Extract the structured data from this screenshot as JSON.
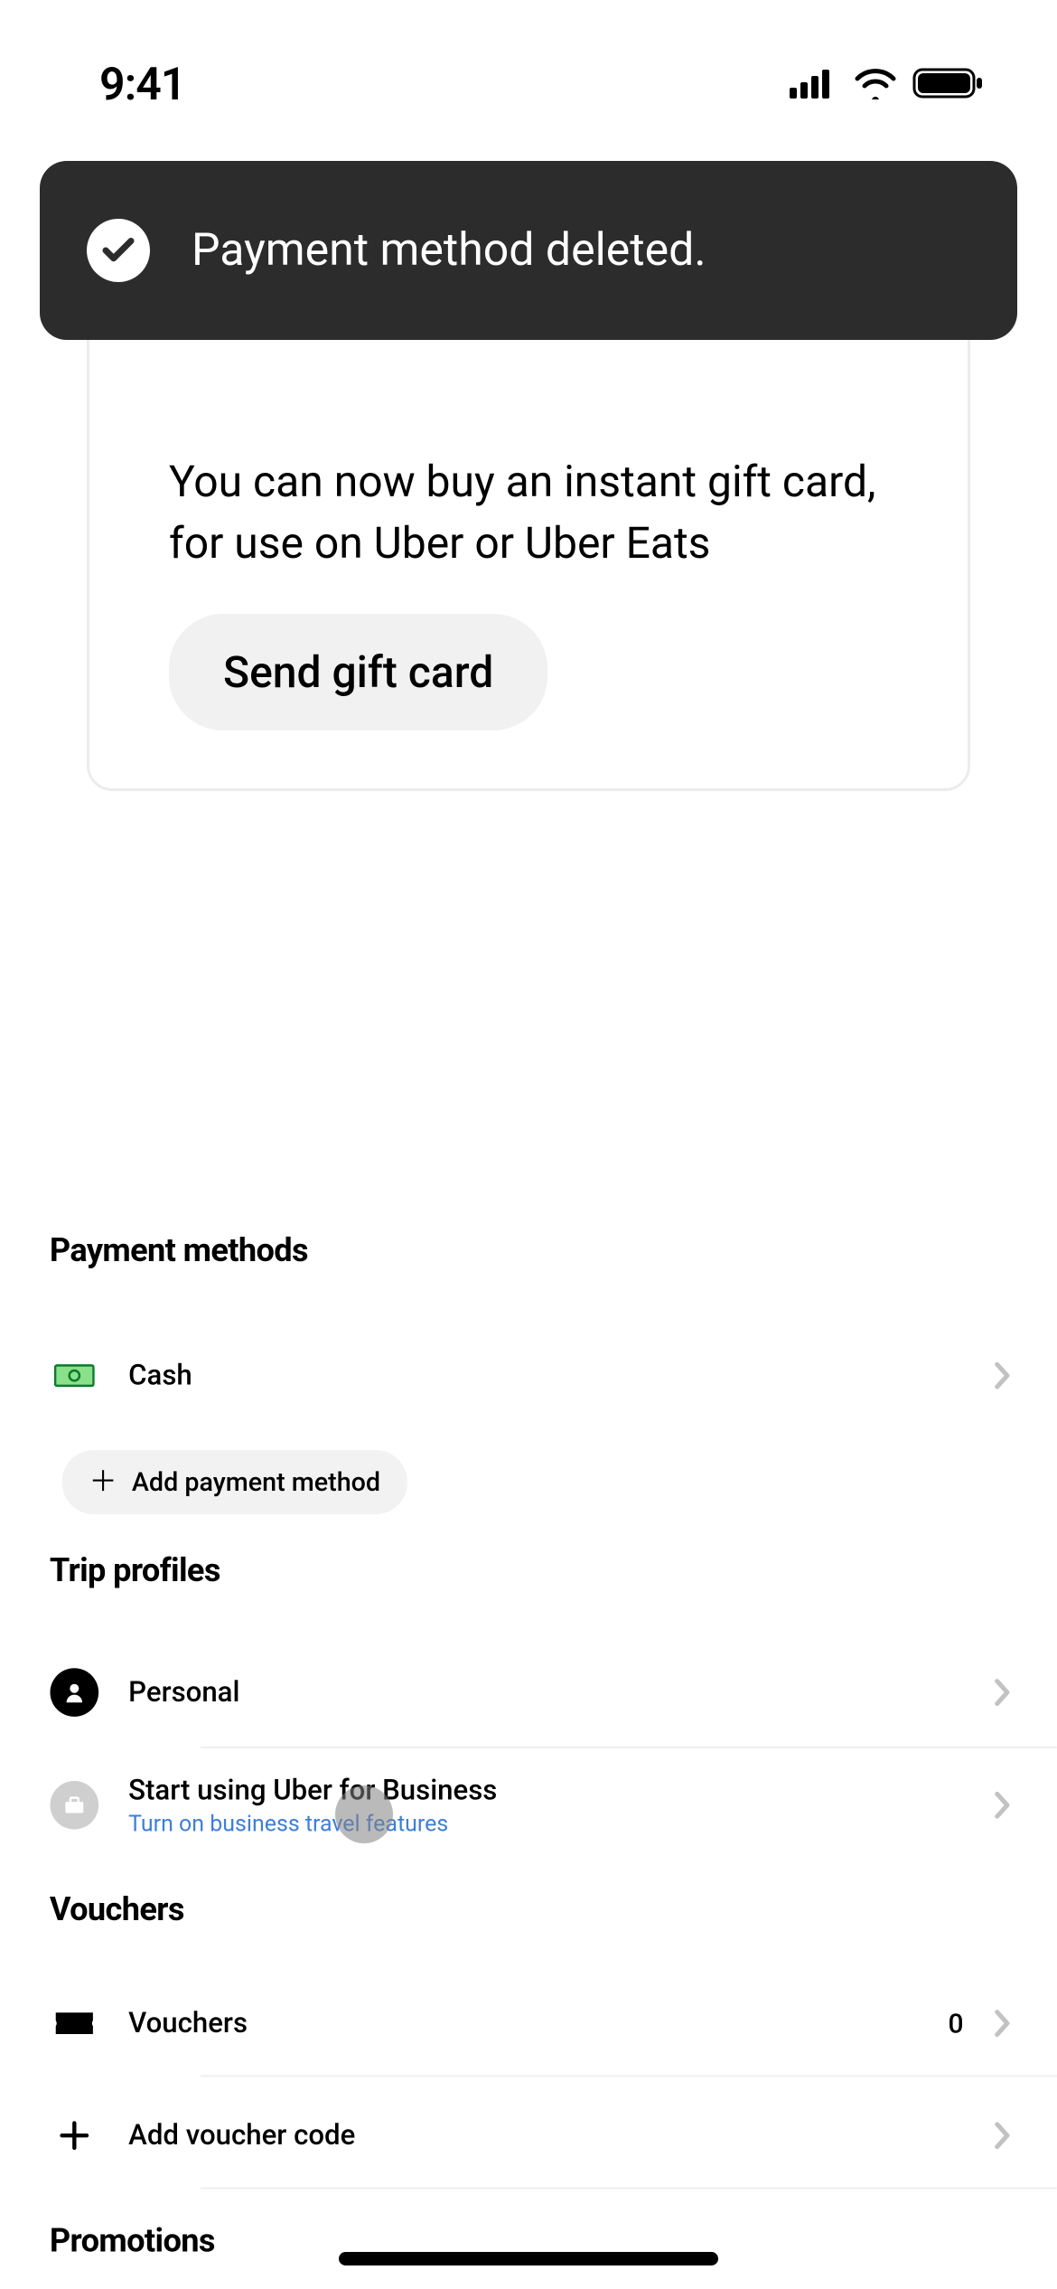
{
  "status": {
    "time": "9:41"
  },
  "toast": {
    "message": "Payment method deleted."
  },
  "gift_card": {
    "text": "You can now buy an instant gift card, for use on Uber or Uber Eats",
    "button": "Send gift card"
  },
  "payment_methods": {
    "heading": "Payment methods",
    "items": [
      {
        "label": "Cash",
        "icon": "cash-icon"
      }
    ],
    "add_button": "Add payment method"
  },
  "trip_profiles": {
    "heading": "Trip profiles",
    "items": [
      {
        "label": "Personal",
        "icon": "person-icon"
      },
      {
        "label": "Start using Uber for Business",
        "sublabel": "Turn on business travel features",
        "icon": "briefcase-icon"
      }
    ]
  },
  "vouchers": {
    "heading": "Vouchers",
    "items": [
      {
        "label": "Vouchers",
        "icon": "voucher-icon",
        "count": "0"
      },
      {
        "label": "Add voucher code",
        "icon": "plus-icon"
      }
    ]
  },
  "promotions": {
    "heading": "Promotions"
  }
}
